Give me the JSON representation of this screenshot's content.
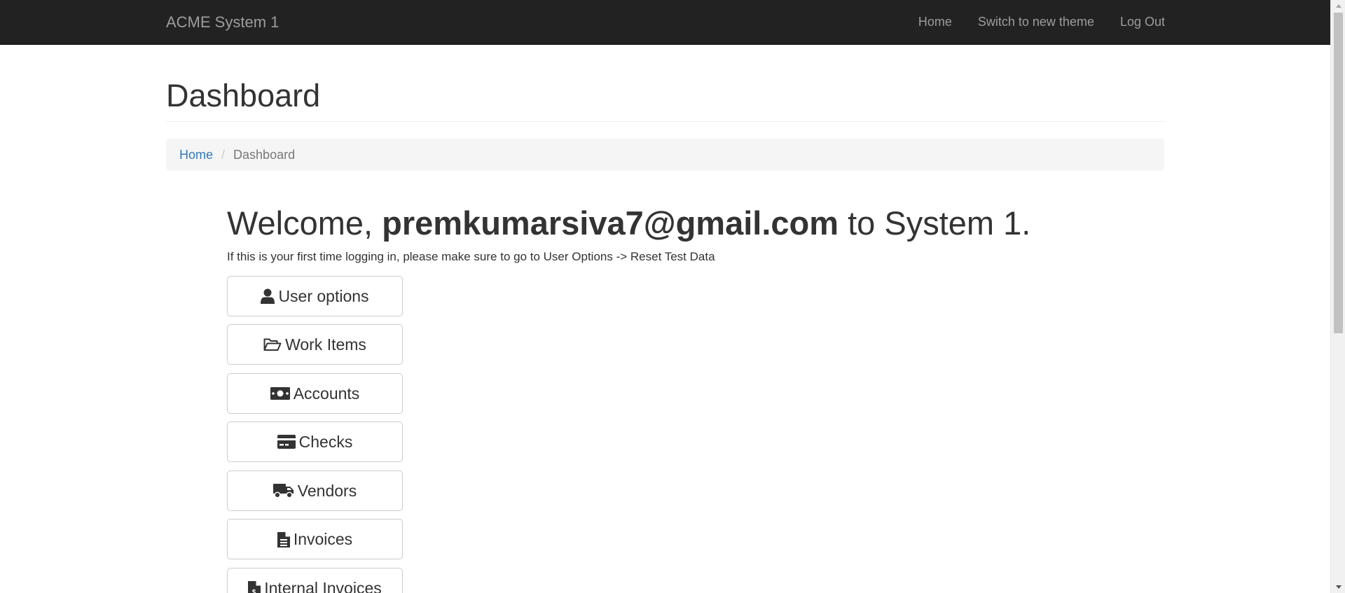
{
  "navbar": {
    "brand": "ACME System 1",
    "links": [
      "Home",
      "Switch to new theme",
      "Log Out"
    ]
  },
  "page": {
    "title": "Dashboard"
  },
  "breadcrumb": {
    "home": "Home",
    "current": "Dashboard"
  },
  "welcome": {
    "prefix": "Welcome, ",
    "email": "premkumarsiva7@gmail.com",
    "suffix": " to System 1.",
    "notice": "If this is your first time logging in, please make sure to go to User Options -> Reset Test Data"
  },
  "buttons": [
    {
      "label": "User options",
      "icon": "user-icon"
    },
    {
      "label": "Work Items",
      "icon": "folder-open-icon"
    },
    {
      "label": "Accounts",
      "icon": "money-icon"
    },
    {
      "label": "Checks",
      "icon": "credit-card-icon"
    },
    {
      "label": "Vendors",
      "icon": "truck-icon"
    },
    {
      "label": "Invoices",
      "icon": "file-text-icon"
    },
    {
      "label": "Internal Invoices",
      "icon": "file-invoice-dollar-icon"
    }
  ],
  "colors": {
    "navbar_bg": "#222222",
    "navbar_text": "#9d9d9d",
    "link": "#337ab7",
    "breadcrumb_bg": "#f5f5f5"
  }
}
